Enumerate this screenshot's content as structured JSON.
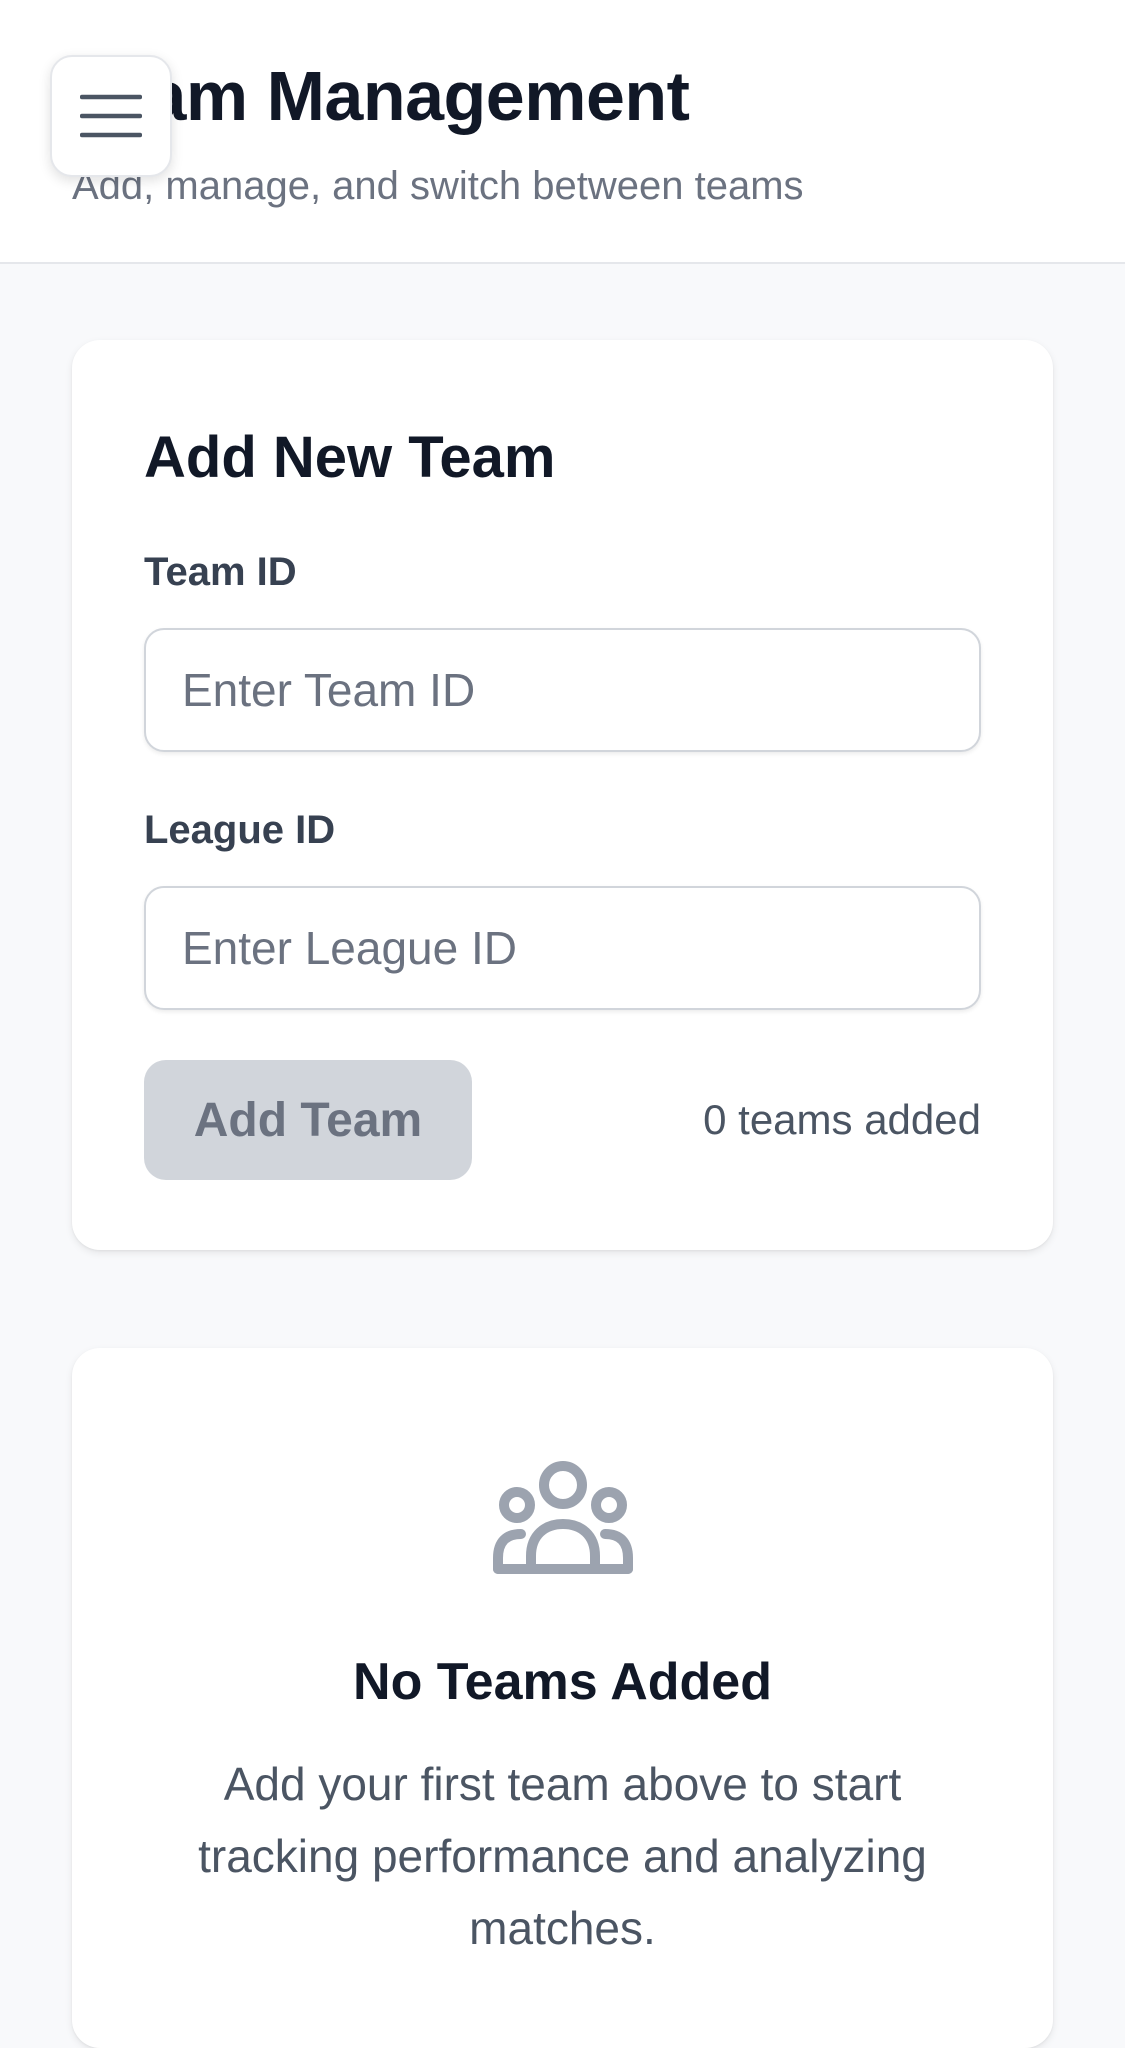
{
  "header": {
    "title": "Team Management",
    "subtitle": "Add, manage, and switch between teams",
    "menu_icon": "hamburger-menu-icon"
  },
  "add_team_form": {
    "title": "Add New Team",
    "team_id": {
      "label": "Team ID",
      "value": "",
      "placeholder": "Enter Team ID"
    },
    "league_id": {
      "label": "League ID",
      "value": "",
      "placeholder": "Enter League ID"
    },
    "submit_label": "Add Team",
    "submit_disabled": true,
    "team_count_text": "0 teams added"
  },
  "empty_state": {
    "icon": "users-group-icon",
    "title": "No Teams Added",
    "message": "Add your first team above to start tracking performance and analyzing matches."
  },
  "colors": {
    "page_background": "#f8f9fb",
    "card_background": "#ffffff",
    "heading_text": "#111827",
    "muted_text": "#6b7280",
    "disabled_button": "#d1d5db",
    "icon_gray": "#9ca3af"
  }
}
